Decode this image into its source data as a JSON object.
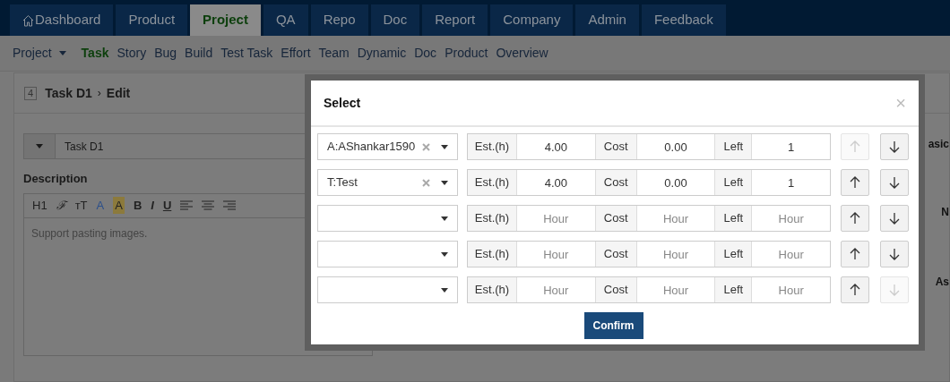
{
  "main_nav": [
    {
      "label": "Dashboard",
      "selected": false
    },
    {
      "label": "Product",
      "selected": false
    },
    {
      "label": "Project",
      "selected": true
    },
    {
      "label": "QA",
      "selected": false
    },
    {
      "label": "Repo",
      "selected": false
    },
    {
      "label": "Doc",
      "selected": false
    },
    {
      "label": "Report",
      "selected": false
    },
    {
      "label": "Company",
      "selected": false
    },
    {
      "label": "Admin",
      "selected": false
    },
    {
      "label": "Feedback",
      "selected": false
    }
  ],
  "sub_nav": {
    "switcher": "Project",
    "items": [
      {
        "label": "Task",
        "selected": true
      },
      {
        "label": "Story",
        "selected": false
      },
      {
        "label": "Bug",
        "selected": false
      },
      {
        "label": "Build",
        "selected": false
      },
      {
        "label": "Test Task",
        "selected": false
      },
      {
        "label": "Effort",
        "selected": false
      },
      {
        "label": "Team",
        "selected": false
      },
      {
        "label": "Dynamic",
        "selected": false
      },
      {
        "label": "Doc",
        "selected": false
      },
      {
        "label": "Product",
        "selected": false
      },
      {
        "label": "Overview",
        "selected": false
      }
    ]
  },
  "page": {
    "id": "4",
    "title": "Task D1",
    "separator": "›",
    "action": "Edit"
  },
  "form": {
    "name_value": "Task D1",
    "description_label": "Description",
    "toolbar": [
      "H1",
      "ℱ",
      "ᴛT",
      "A",
      "A",
      "B",
      "I",
      "U"
    ],
    "editor_text": "Support pasting images."
  },
  "side_panel": {
    "labels": [
      "asic",
      "N",
      "As"
    ]
  },
  "dialog": {
    "title": "Select",
    "close": "×",
    "rows": [
      {
        "member": "A:AShankar1590",
        "est_label": "Est.(h)",
        "estimate": {
          "value": "4.00"
        },
        "cost_label": "Cost",
        "cost": {
          "value": "0.00"
        },
        "left_label": "Left",
        "left": {
          "value": "1"
        },
        "up_disabled": true,
        "down_disabled": false
      },
      {
        "member": "T:Test",
        "est_label": "Est.(h)",
        "estimate": {
          "value": "4.00"
        },
        "cost_label": "Cost",
        "cost": {
          "value": "0.00"
        },
        "left_label": "Left",
        "left": {
          "value": "1"
        },
        "up_disabled": false,
        "down_disabled": false
      },
      {
        "est_label": "Est.(h)",
        "estimate": {
          "placeholder": "Hour"
        },
        "cost_label": "Cost",
        "cost": {
          "placeholder": "Hour"
        },
        "left_label": "Left",
        "left": {
          "placeholder": "Hour"
        },
        "up_disabled": false,
        "down_disabled": false
      },
      {
        "est_label": "Est.(h)",
        "estimate": {
          "placeholder": "Hour"
        },
        "cost_label": "Cost",
        "cost": {
          "placeholder": "Hour"
        },
        "left_label": "Left",
        "left": {
          "placeholder": "Hour"
        },
        "up_disabled": false,
        "down_disabled": false
      },
      {
        "est_label": "Est.(h)",
        "estimate": {
          "placeholder": "Hour"
        },
        "cost_label": "Cost",
        "cost": {
          "placeholder": "Hour"
        },
        "left_label": "Left",
        "left": {
          "placeholder": "Hour"
        },
        "up_disabled": false,
        "down_disabled": true
      }
    ],
    "confirm": "Confirm"
  }
}
